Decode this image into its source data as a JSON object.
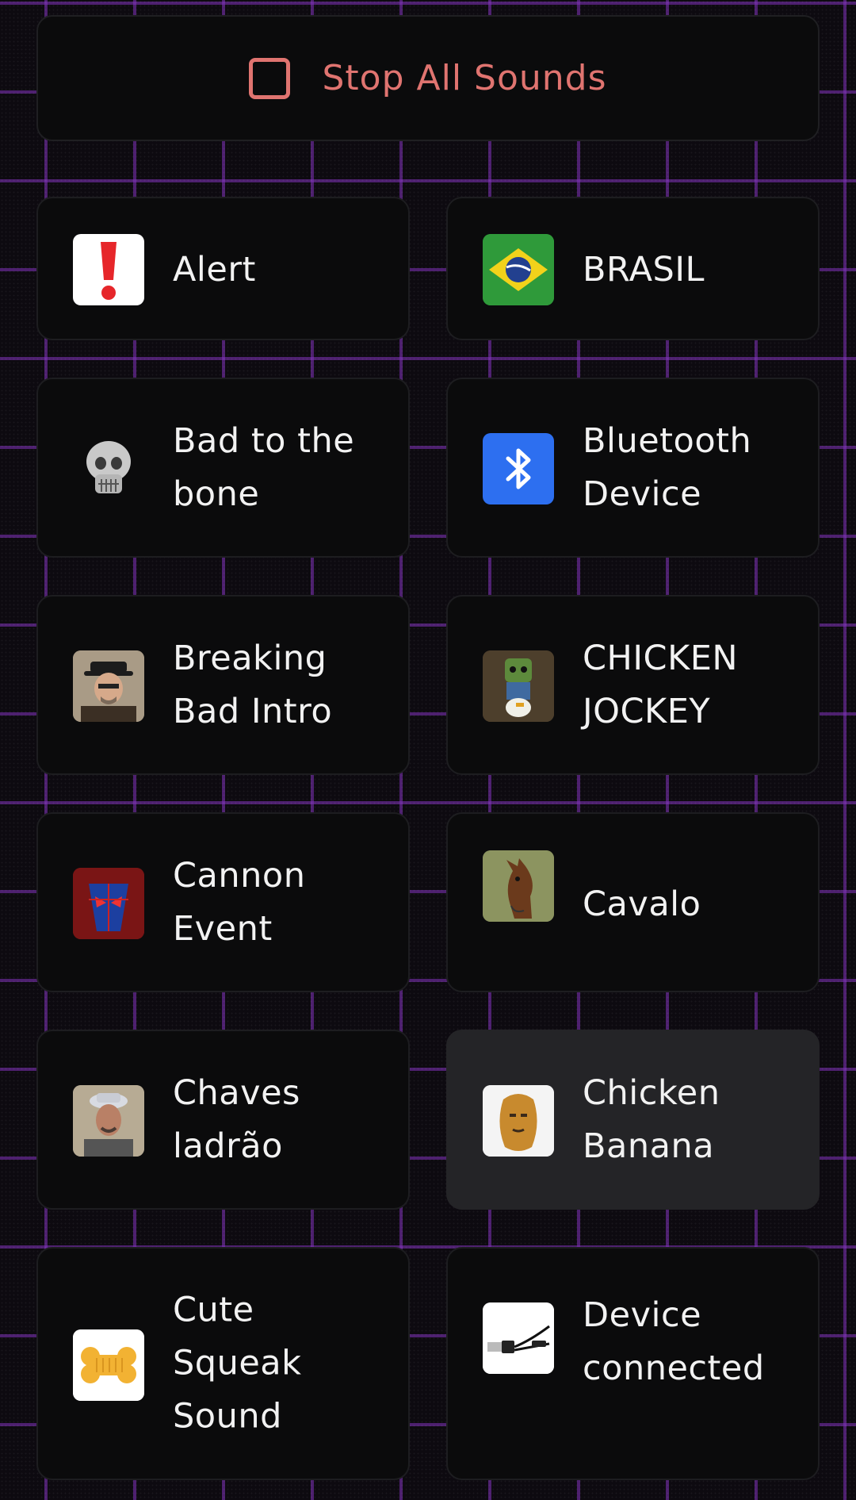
{
  "stop": {
    "label": "Stop All Sounds",
    "icon": "stop-square-icon",
    "color": "#e07470"
  },
  "sounds": [
    {
      "name": "Alert",
      "icon": "exclamation-icon"
    },
    {
      "name": "BRASIL",
      "icon": "brazil-flag-icon"
    },
    {
      "name": "Bad to the bone",
      "icon": "skull-icon"
    },
    {
      "name": "Bluetooth Device",
      "icon": "bluetooth-icon"
    },
    {
      "name": "Breaking Bad Intro",
      "icon": "heisenberg-photo-icon"
    },
    {
      "name": "CHICKEN JOCKEY",
      "icon": "zombie-chicken-icon"
    },
    {
      "name": "Cannon Event",
      "icon": "spiderman-icon"
    },
    {
      "name": "Cavalo",
      "icon": "horse-photo-icon"
    },
    {
      "name": "Chaves ladrão",
      "icon": "man-with-hat-photo-icon"
    },
    {
      "name": "Chicken Banana",
      "icon": "chicken-nugget-face-icon"
    },
    {
      "name": "Cute Squeak Sound",
      "icon": "dog-bone-toy-icon"
    },
    {
      "name": "Device connected",
      "icon": "usb-cable-icon"
    }
  ]
}
